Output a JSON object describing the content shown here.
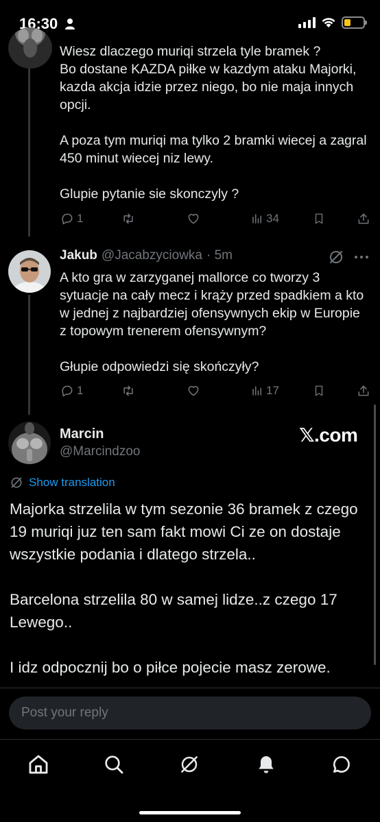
{
  "status_bar": {
    "time": "16:30",
    "battery_level": 0.2,
    "battery_color": "#f5c518"
  },
  "tweet1": {
    "text": "Wiesz dlaczego muriqi strzela tyle bramek ?\nBo dostane KAZDA piłke w kazdym ataku Majorki, kazda akcja idzie przez niego, bo nie maja innych opcji.\n\nA poza tym muriqi ma tylko 2 bramki wiecej a zagral 450 minut wiecej  niz lewy.\n\nGlupie pytanie sie skonczyly ?",
    "replies": "1",
    "views": "34"
  },
  "tweet2": {
    "name": "Jakub",
    "handle": "@Jacabzyciowka",
    "time": "· 5m",
    "text": "A kto gra w zarzyganej mallorce co tworzy 3 sytuacje na cały mecz i krąży przed spadkiem a kto w jednej z najbardziej ofensywnych ekip w Europie z topowym trenerem ofensywnym?\n\nGłupie odpowiedzi się skończyły?",
    "replies": "1",
    "views": "17"
  },
  "main_tweet": {
    "name": "Marcin",
    "handle": "@Marcindzoo",
    "watermark": "𝕏.com",
    "translate_label": "Show translation",
    "text": "Majorka strzelila w tym sezonie 36 bramek z czego 19 muriqi juz ten sam fakt mowi Ci ze on dostaje wszystkie podania i dlatego strzela..\n\nBarcelona strzelila 80 w samej lidze..z czego 17 Lewego..\n\nI idz odpocznij bo o piłce pojecie masz zerowe."
  },
  "reply": {
    "placeholder": "Post your reply"
  },
  "tabbar": {
    "items": [
      {
        "icon": "home-icon"
      },
      {
        "icon": "search-icon"
      },
      {
        "icon": "grok-icon"
      },
      {
        "icon": "notifications-icon"
      },
      {
        "icon": "messages-icon"
      }
    ]
  },
  "colors": {
    "accent": "#1d9bf0",
    "muted": "#71767b",
    "text": "#e7e9ea",
    "background": "#000000"
  }
}
